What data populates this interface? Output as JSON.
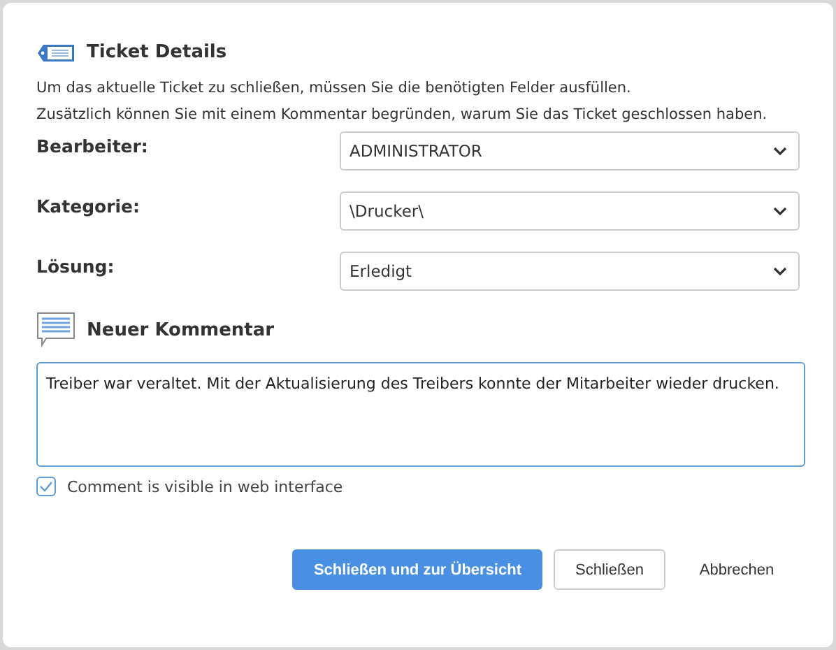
{
  "header": {
    "title": "Ticket Details"
  },
  "intro": [
    "Um das aktuelle Ticket zu schließen, müssen Sie die benötigten Felder ausfüllen.",
    "Zusätzlich können Sie mit einem Kommentar begründen, warum Sie das Ticket geschlossen haben."
  ],
  "fields": [
    {
      "label": "Bearbeiter:",
      "value": "ADMINISTRATOR"
    },
    {
      "label": "Kategorie:",
      "value": "\\Drucker\\"
    },
    {
      "label": "Lösung:",
      "value": "Erledigt"
    }
  ],
  "comment": {
    "title": "Neuer Kommentar",
    "value": "Treiber war veraltet. Mit der Aktualisierung des Treibers konnte der Mitarbeiter wieder drucken."
  },
  "visible_checkbox": {
    "label": "Comment is visible in web interface",
    "checked": true
  },
  "buttons": [
    {
      "label": "Schließen und zur Übersicht",
      "kind": "primary"
    },
    {
      "label": "Schließen",
      "kind": "secondary"
    },
    {
      "label": "Abbrechen",
      "kind": "plain"
    }
  ]
}
